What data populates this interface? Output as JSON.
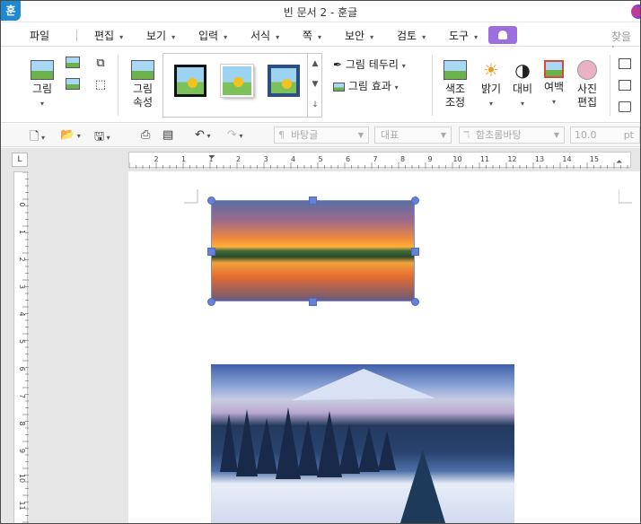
{
  "window": {
    "title": "빈 문서 2 - 훈글",
    "app_icon": "훈"
  },
  "menu": {
    "items": [
      "파일",
      "편집",
      "보기",
      "입력",
      "서식",
      "쪽",
      "보안",
      "검토",
      "도구"
    ],
    "search_hint": "찾을 L"
  },
  "ribbon": {
    "picture": "그림",
    "picture_props_1": "그림",
    "picture_props_2": "속성",
    "border": "그림 테두리",
    "effect": "그림 효과",
    "color_adj_1": "색조",
    "color_adj_2": "조정",
    "brightness": "밝기",
    "contrast": "대비",
    "margin": "여백",
    "photo_edit_1": "사진",
    "photo_edit_2": "편집"
  },
  "toolbar2": {
    "style": "바탕글",
    "outline": "대표",
    "font": "함초롬바탕",
    "size": "10.0",
    "unit": "pt"
  },
  "ruler": {
    "h_ticks": [
      "2",
      "1",
      "1",
      "2",
      "3",
      "4",
      "5",
      "6",
      "7",
      "8",
      "9",
      "10",
      "11",
      "12",
      "13",
      "14",
      "15"
    ],
    "v_ticks": [
      "0",
      "1",
      "2",
      "3",
      "4",
      "5",
      "6",
      "7",
      "8",
      "9",
      "10",
      "11"
    ]
  },
  "colors": {
    "accent": "#9b6fdc",
    "selection": "#6781d4",
    "app": "#1f8ad1"
  }
}
